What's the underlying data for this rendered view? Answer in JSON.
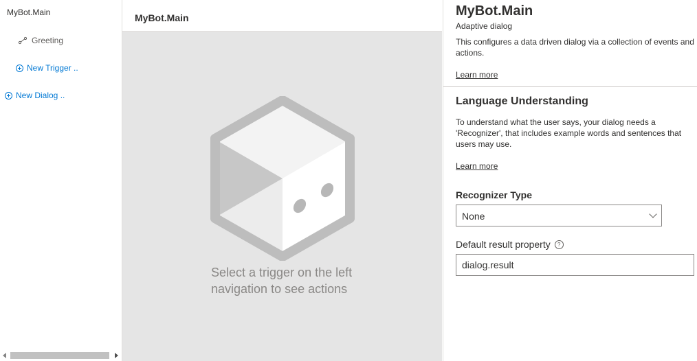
{
  "nav": {
    "root_label": "MyBot.Main",
    "trigger_label": "Greeting",
    "new_trigger_label": "New Trigger ..",
    "new_dialog_label": "New Dialog .."
  },
  "center": {
    "title": "MyBot.Main",
    "empty_message": "Select a trigger on the left navigation to see actions"
  },
  "properties": {
    "title": "MyBot.Main",
    "subtitle": "Adaptive dialog",
    "description": "This configures a data driven dialog via a collection of events and actions.",
    "learn_more_1": "Learn more",
    "lu_title": "Language Understanding",
    "lu_description": "To understand what the user says, your dialog needs a 'Recognizer', that includes example words and sentences that users may use.",
    "learn_more_2": "Learn more",
    "recognizer_label": "Recognizer Type",
    "recognizer_value": "None",
    "default_result_label": "Default result property",
    "default_result_value": "dialog.result"
  },
  "icons": {
    "trigger": "trigger-icon",
    "add": "add-circle-icon",
    "info": "info-icon",
    "dropdown": "chevron-down-icon"
  },
  "colors": {
    "link": "#0078d4",
    "canvas_bg": "#e5e5e5",
    "text": "#323130"
  }
}
